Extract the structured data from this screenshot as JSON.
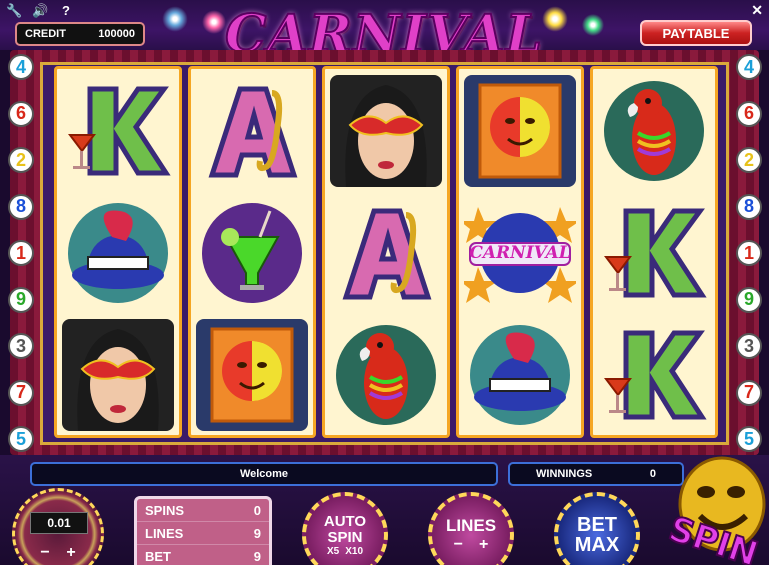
{
  "toolbar": {
    "icons": [
      "wrench-icon",
      "speaker-icon",
      "help-icon"
    ],
    "close": "✕"
  },
  "credit": {
    "label": "CREDIT",
    "value": "100000"
  },
  "paytable_label": "PAYTABLE",
  "logo_text": "CARNIVAL",
  "left_lines": [
    "4",
    "6",
    "2",
    "8",
    "1",
    "9",
    "3",
    "7",
    "5"
  ],
  "right_lines": [
    "4",
    "6",
    "2",
    "8",
    "1",
    "9",
    "3",
    "7",
    "5"
  ],
  "line_colors": [
    "#1a9fd8",
    "#d8281a",
    "#e8c21a",
    "#1a4fd8",
    "#d8281a",
    "#2aa82a",
    "#555555",
    "#d8281a",
    "#1a9fd8"
  ],
  "reels": [
    [
      "K",
      "hat",
      "mask-woman"
    ],
    [
      "A",
      "cocktail",
      "banner"
    ],
    [
      "mask-woman",
      "A",
      "parrot"
    ],
    [
      "banner",
      "carnival-badge",
      "hat"
    ],
    [
      "parrot",
      "K",
      "K"
    ]
  ],
  "badge_text": "CARNIVAL",
  "welcome_text": "Welcome",
  "winnings": {
    "label": "WINNINGS",
    "value": "0"
  },
  "coin": {
    "value": "0.01",
    "minus": "−",
    "plus": "+"
  },
  "stats": [
    {
      "label": "SPINS",
      "value": "0"
    },
    {
      "label": "LINES",
      "value": "9"
    },
    {
      "label": "BET",
      "value": "9"
    }
  ],
  "autospin": {
    "line1": "AUTO",
    "line2": "SPIN",
    "x5": "X5",
    "x10": "X10"
  },
  "lines_btn": {
    "label": "LINES",
    "minus": "−",
    "plus": "+"
  },
  "betmax": {
    "line1": "BET",
    "line2": "MAX"
  },
  "spin_label": "SPIN"
}
